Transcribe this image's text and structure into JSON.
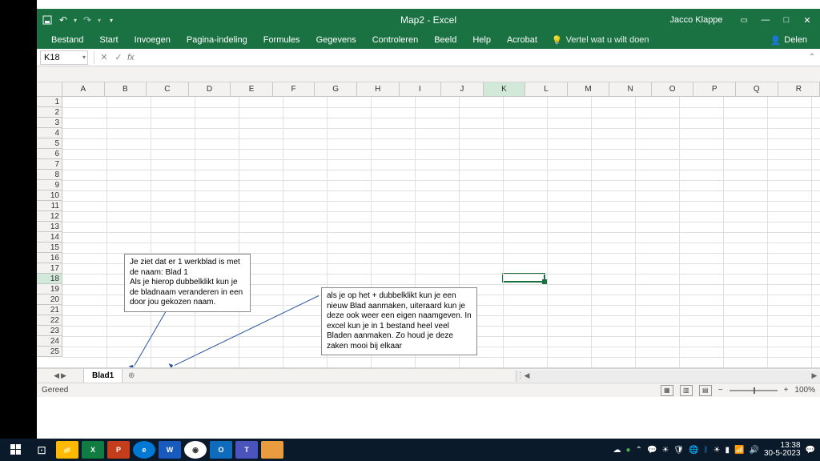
{
  "titlebar": {
    "title": "Map2 - Excel",
    "user": "Jacco Klappe"
  },
  "menu": {
    "items": [
      "Bestand",
      "Start",
      "Invoegen",
      "Pagina-indeling",
      "Formules",
      "Gegevens",
      "Controleren",
      "Beeld",
      "Help",
      "Acrobat"
    ],
    "tellMe": "Vertel wat u wilt doen",
    "share": "Delen"
  },
  "nameBox": "K18",
  "fxLabel": "fx",
  "columns": [
    "A",
    "B",
    "C",
    "D",
    "E",
    "F",
    "G",
    "H",
    "I",
    "J",
    "K",
    "L",
    "M",
    "N",
    "O",
    "P",
    "Q",
    "R"
  ],
  "rows": [
    "1",
    "2",
    "3",
    "4",
    "5",
    "6",
    "7",
    "8",
    "9",
    "10",
    "11",
    "12",
    "13",
    "14",
    "15",
    "16",
    "17",
    "18",
    "19",
    "20",
    "21",
    "22",
    "23",
    "24",
    "25"
  ],
  "activeCol": "K",
  "activeRow": "18",
  "callout1": "Je ziet dat er 1 werkblad is met de naam: Blad 1\nAls je hierop dubbelklikt kun je de bladnaam veranderen in een door jou gekozen naam.",
  "callout2": "als je op het + dubbelklikt kun je een nieuw Blad aanmaken, uiteraard kun je deze ook weer een eigen naamgeven. In excel kun je in 1 bestand heel veel Bladen aanmaken. Zo houd je deze zaken mooi bij elkaar",
  "sheetTab": "Blad1",
  "status": {
    "ready": "Gereed",
    "zoom": "100%"
  },
  "taskbar": {
    "time": "13:38",
    "date": "30-5-2023"
  }
}
